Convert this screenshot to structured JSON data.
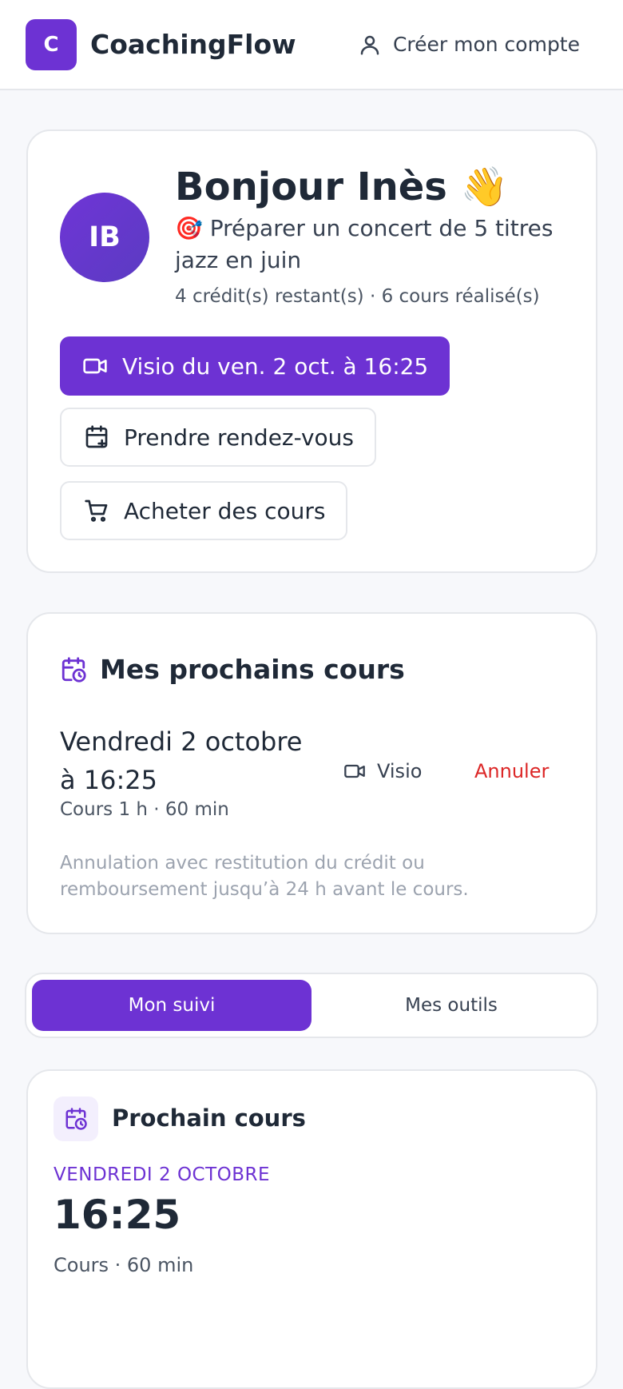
{
  "header": {
    "logo_letter": "C",
    "app_name": "CoachingFlow",
    "account_label": "Créer mon compte"
  },
  "hero": {
    "avatar_initials": "IB",
    "greeting": "Bonjour Inès 👋",
    "goal": "🎯 Préparer un concert de 5 titres jazz en juin",
    "stats": "4 crédit(s) restant(s) · 6 cours réalisé(s)",
    "visio_button": "Visio du ven. 2 oct. à 16:25",
    "book_button": "Prendre rendez-vous",
    "buy_button": "Acheter des cours"
  },
  "next_lessons": {
    "title": "Mes prochains cours",
    "lesson": {
      "date_line1": "Vendredi 2 octobre",
      "date_line2": "à 16:25",
      "meta": "Cours 1 h · 60 min",
      "mode": "Visio",
      "cancel": "Annuler"
    },
    "policy": "Annulation avec restitution du crédit ou remboursement jusqu’à 24 h avant le cours."
  },
  "tabs": [
    {
      "label": "Mon suivi",
      "active": true
    },
    {
      "label": "Mes outils",
      "active": false
    }
  ],
  "upcoming": {
    "title": "Prochain cours",
    "date": "VENDREDI 2 OCTOBRE",
    "time": "16:25",
    "meta": "Cours · 60 min"
  },
  "colors": {
    "accent": "#6d32d3",
    "danger": "#dc2626",
    "background": "#f7f8fb"
  },
  "icons": {
    "account": "user-icon",
    "visio": "video-camera-icon",
    "book": "calendar-plus-icon",
    "buy": "shopping-cart-icon",
    "schedule": "calendar-clock-icon"
  }
}
